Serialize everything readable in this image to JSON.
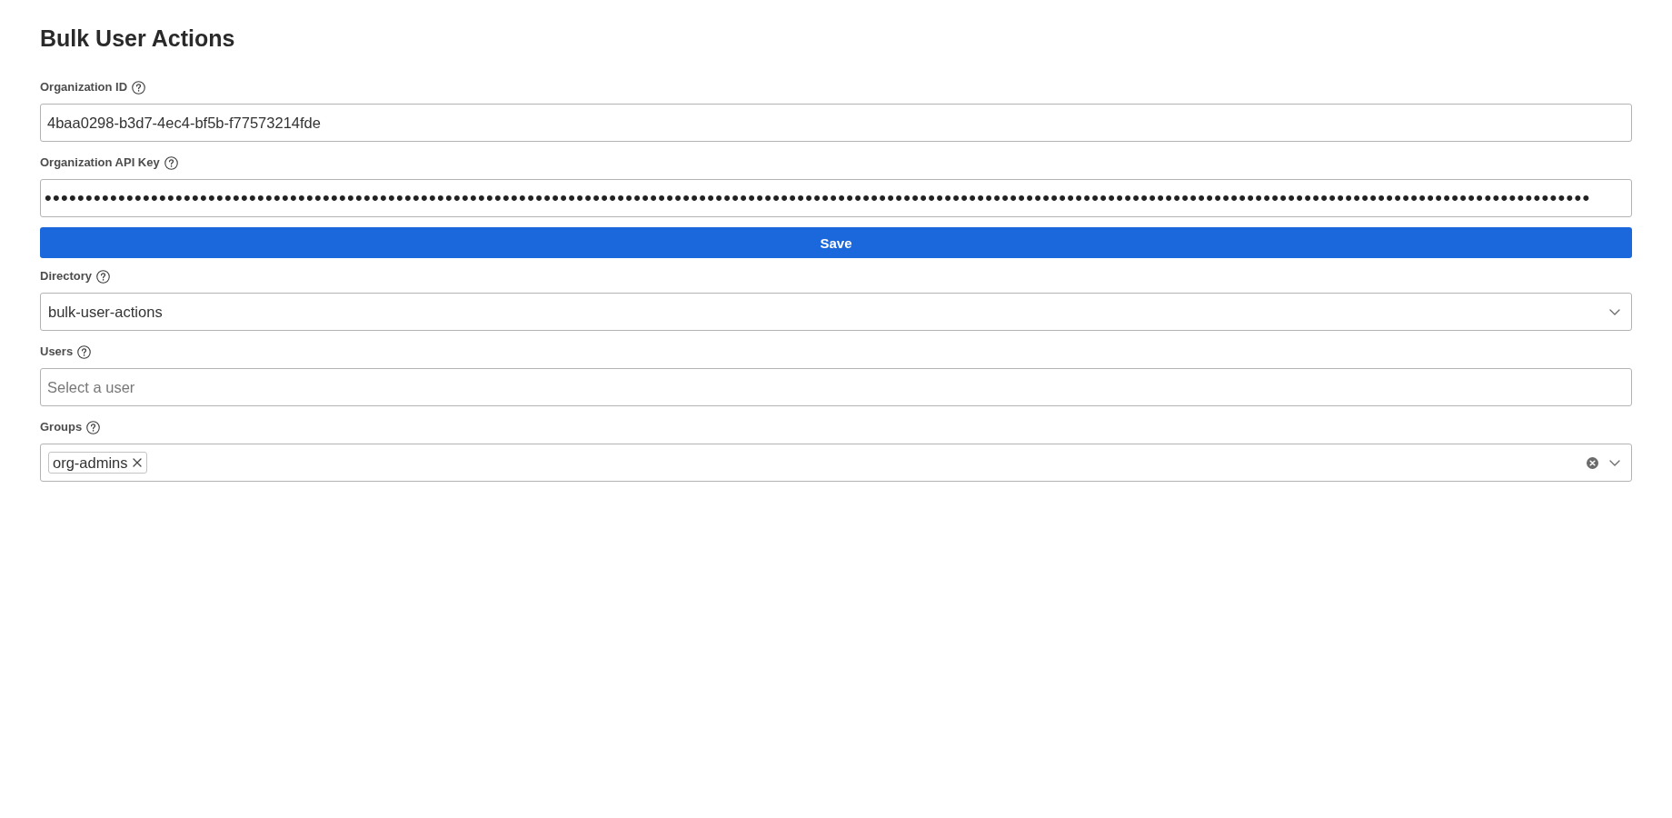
{
  "title": "Bulk User Actions",
  "fields": [
    {
      "kind": "text",
      "label": "Organization ID",
      "value": "4baa0298-b3d7-4ec4-bf5b-f77573214fde"
    },
    {
      "kind": "password",
      "label": "Organization API Key",
      "value": "•••••••••••••••••••••••••••••••••••••••••••••••••••••••••••••••••••••••••••••••••••••••••••••••••••••••••••••••••••••••••••••••••••••••••••••••••••••••••••••••••••••••••••••••••••••••••••••"
    },
    {
      "kind": "button",
      "label": "Save"
    },
    {
      "kind": "select",
      "label": "Directory",
      "value": "bulk-user-actions"
    },
    {
      "kind": "text",
      "label": "Users",
      "placeholder": "Select a user"
    },
    {
      "kind": "multiselect",
      "label": "Groups",
      "tags": [
        "org-admins"
      ]
    }
  ]
}
